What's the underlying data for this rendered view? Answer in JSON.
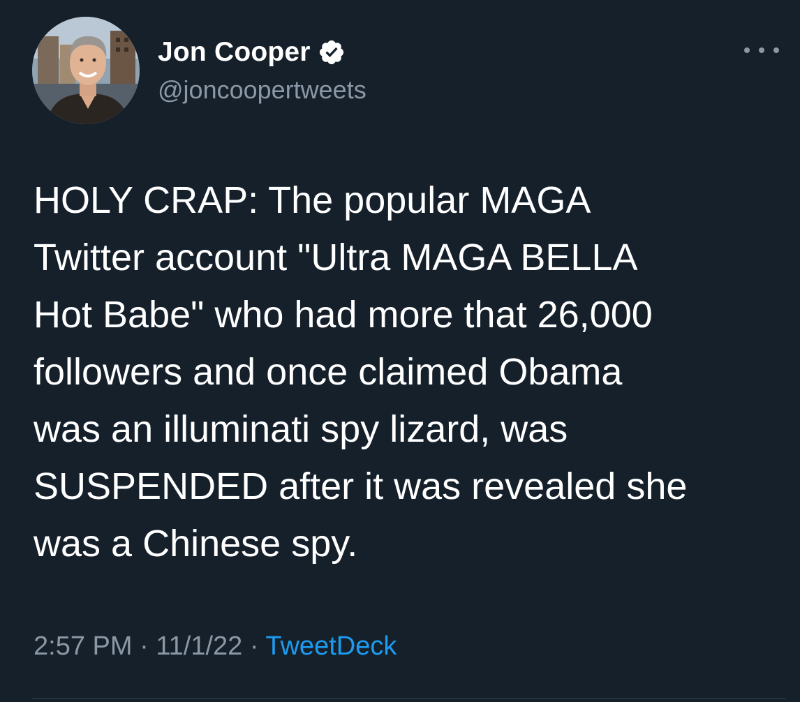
{
  "author": {
    "display_name": "Jon Cooper",
    "handle": "@joncoopertweets",
    "verified": true,
    "verified_icon": "verified-badge-icon",
    "avatar_icon": "profile-photo"
  },
  "tweet": {
    "text": "HOLY CRAP: The popular MAGA\nTwitter account \"Ultra MAGA BELLA\nHot Babe\" who had more that 26,000\nfollowers and once claimed Obama\nwas an illuminati spy lizard, was\nSUSPENDED after it was revealed she\nwas a Chinese spy.",
    "time": "2:57 PM",
    "separator": " · ",
    "date": "11/1/22",
    "source": "TweetDeck"
  },
  "menu": {
    "more_icon": "more-options-icon"
  },
  "colors": {
    "background": "#15202b",
    "text_primary": "#ffffff",
    "text_secondary": "#8b98a5",
    "accent": "#1d9bf0"
  }
}
